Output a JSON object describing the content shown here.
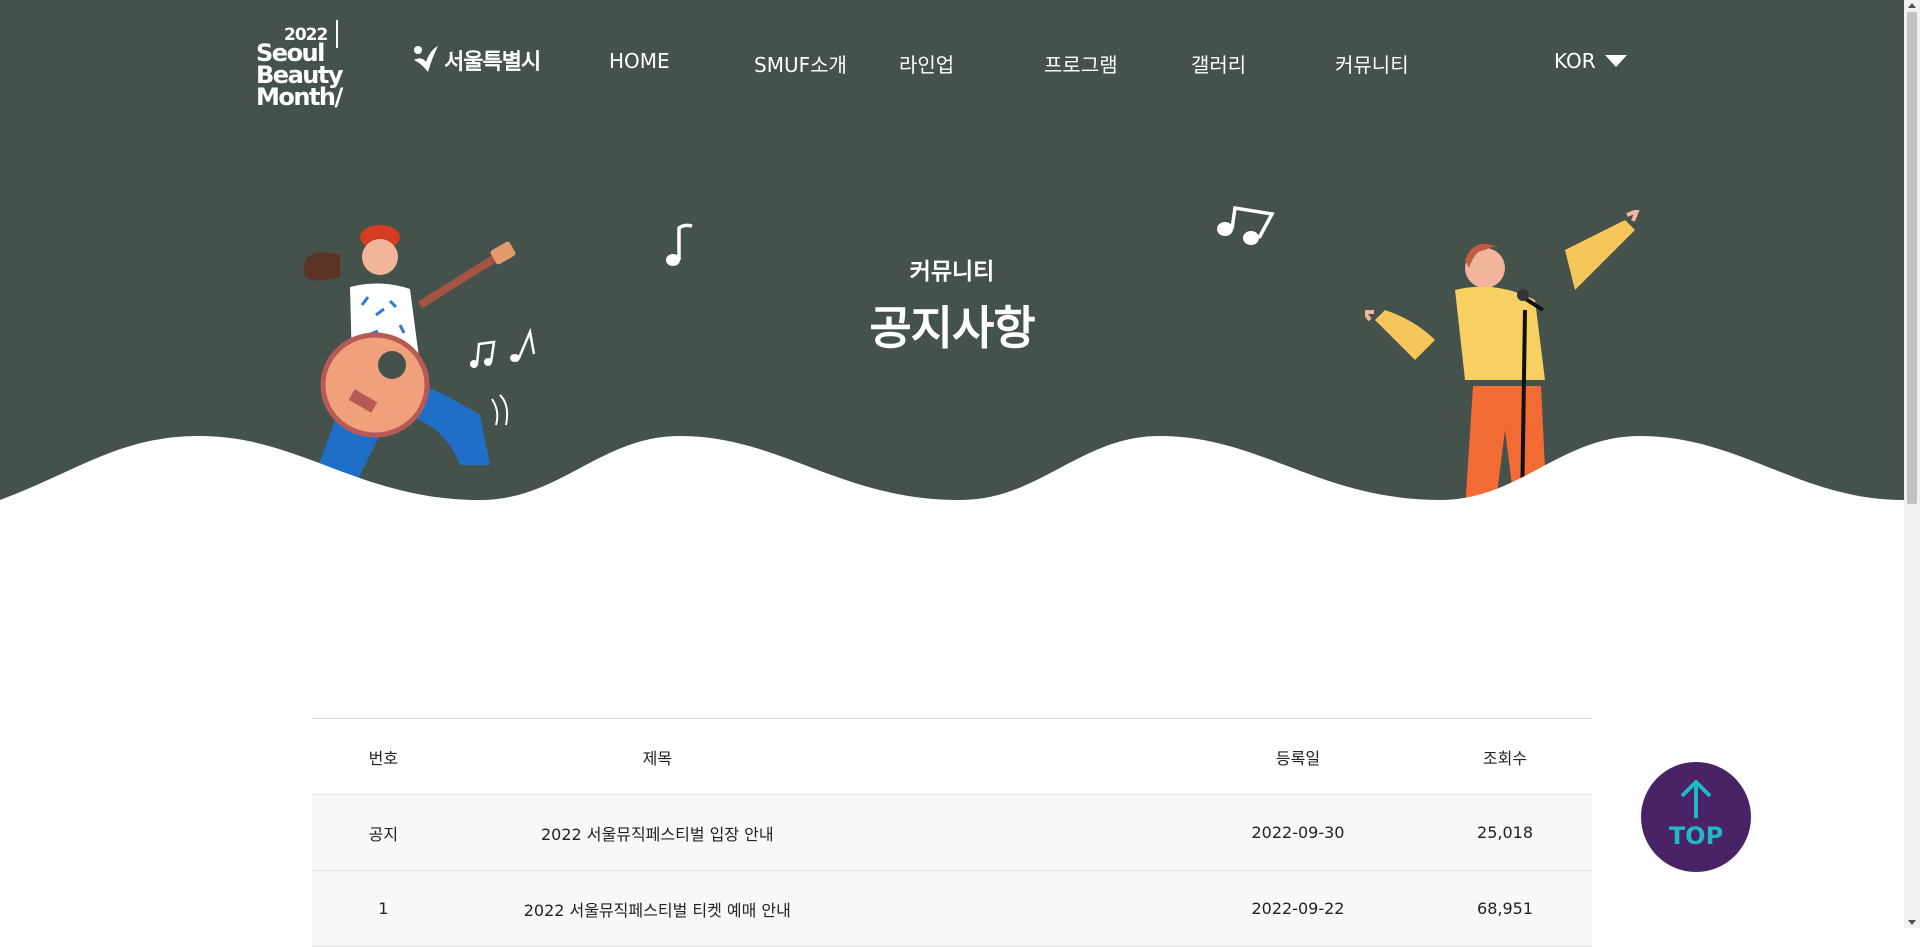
{
  "logo": {
    "year": "2022",
    "line1": "Seoul",
    "line2": "Beauty",
    "line3": "Month/"
  },
  "seoul_logo": {
    "text": "서울특별시"
  },
  "nav": {
    "home": "HOME",
    "about": "SMUF소개",
    "lineup": "라인업",
    "program": "프로그램",
    "gallery": "갤러리",
    "community": "커뮤니티"
  },
  "language": {
    "selected": "KOR"
  },
  "hero": {
    "subtitle": "커뮤니티",
    "title": "공지사항"
  },
  "table": {
    "headers": {
      "no": "번호",
      "title": "제목",
      "date": "등록일",
      "views": "조회수"
    },
    "rows": [
      {
        "no": "공지",
        "title": "2022 서울뮤직페스티벌 입장 안내",
        "date": "2022-09-30",
        "views": "25,018"
      },
      {
        "no": "1",
        "title": "2022 서울뮤직페스티벌 티켓 예매 안내",
        "date": "2022-09-22",
        "views": "68,951"
      }
    ]
  },
  "top_button": {
    "label": "TOP"
  },
  "colors": {
    "header_bg": "#44524b",
    "top_button_bg": "#4a2366",
    "top_button_accent": "#1fb8c4"
  }
}
